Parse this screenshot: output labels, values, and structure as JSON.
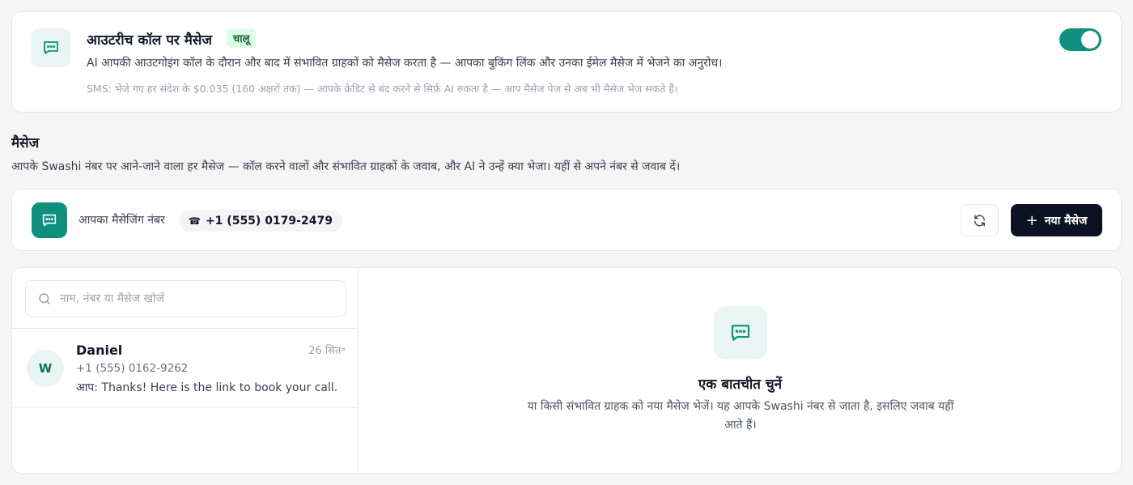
{
  "outreach": {
    "title": "आउटरीच कॉल पर मैसेज",
    "status_badge": "चालू",
    "description": "AI आपकी आउटगोइंग कॉल के दौरान और बाद में संभावित ग्राहकों को मैसेज करता है — आपका बुकिंग लिंक और उनका ईमेल मैसेज में भेजने का अनुरोध।",
    "note": "SMS: भेजे गए हर संदेश के $0.035 (160 अक्षरों तक) — आपके क्रेडिट से    बंद करने से सिर्फ़ AI रुकता है — आप मैसेज पेज से अब भी मैसेज भेज सकते हैं।",
    "toggle_on": true,
    "icon": "chat-bubble-icon"
  },
  "messages": {
    "title": "मैसेज",
    "description": "आपके Swashi नंबर पर आने-जाने वाला हर मैसेज — कॉल करने वालों और संभावित ग्राहकों के जवाब, और AI ने उन्हें क्या भेजा। यहीं से अपने नंबर से जवाब दें।"
  },
  "number_bar": {
    "label": "आपका मैसेजिंग नंबर",
    "phone_icon": "☎",
    "number": "+1 (555) 0179-2479",
    "refresh_icon": "refresh-icon",
    "new_message_label": "नया मैसेज",
    "new_message_icon": "+"
  },
  "inbox": {
    "search_placeholder": "नाम, नंबर या मैसेज खोजें",
    "conversations": [
      {
        "initial": "W",
        "name": "Daniel",
        "date": "26 सित॰",
        "phone": "+1 (555) 0162-9262",
        "preview": "आप: Thanks! Here is the link to book your call."
      }
    ],
    "empty_state": {
      "title": "एक बातचीत चुनें",
      "description": "या किसी संभावित ग्राहक को नया मैसेज भेजें। यह आपके Swashi नंबर से जाता है, इसलिए जवाब यहीं आते हैं।"
    }
  },
  "colors": {
    "accent": "#0f8f7d",
    "accent_light": "#e8f5f2",
    "dark_button": "#0b1221",
    "badge_bg": "#dcfce7",
    "badge_text": "#166534"
  }
}
